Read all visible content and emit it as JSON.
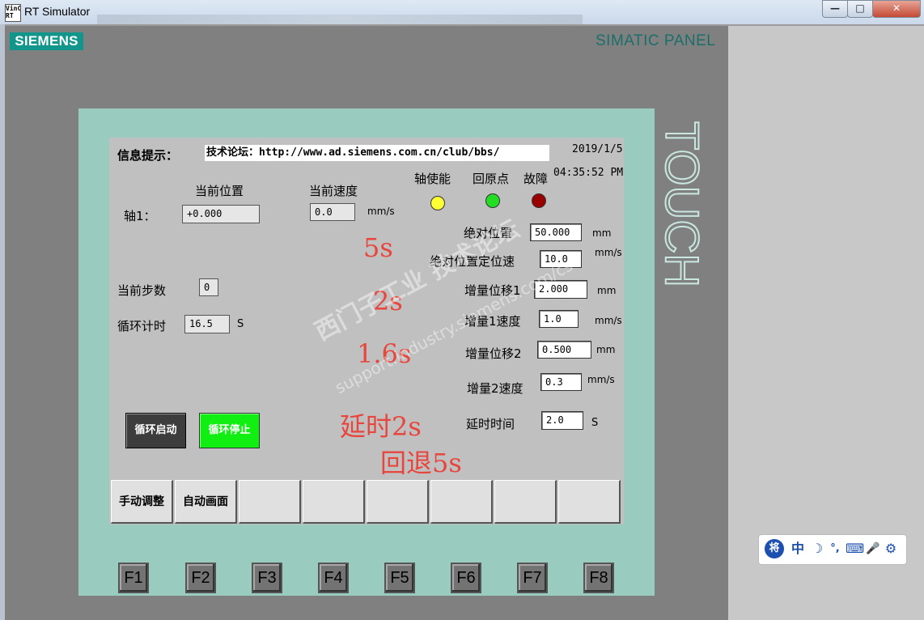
{
  "window": {
    "app_icon_text": "VinC\nRT",
    "title": "RT Simulator",
    "min_label": "—",
    "max_label": "□",
    "close_label": "✕"
  },
  "panel": {
    "brand": "SIEMENS",
    "model": "SIMATIC PANEL",
    "touch": "TOUCH"
  },
  "screen": {
    "info_label": "信息提示：",
    "info_text": "技术论坛：http://www.ad.siemens.com.cn/club/bbs/",
    "date": "2019/1/5",
    "time": "04:35:52 PM",
    "axis_label": "轴1：",
    "current_position_label": "当前位置",
    "current_position_value": "+0.000",
    "current_speed_label": "当前速度",
    "current_speed_value": "0.0",
    "current_speed_unit": "mm/s",
    "indicators": [
      {
        "label": "轴使能",
        "color": "#ffff33"
      },
      {
        "label": "回原点",
        "color": "#22dd22"
      },
      {
        "label": "故障",
        "color": "#990000"
      }
    ],
    "current_step_label": "当前步数",
    "current_step_value": "0",
    "cycle_time_label": "循环计时",
    "cycle_time_value": "16.5",
    "cycle_time_unit": "S",
    "params": [
      {
        "label": "绝对位置",
        "value": "50.000",
        "unit": "mm"
      },
      {
        "label": "绝对位置定位速",
        "value": "10.0",
        "unit": "mm/s"
      },
      {
        "label": "增量位移1",
        "value": "2.000",
        "unit": "mm"
      },
      {
        "label": "增量1速度",
        "value": "1.0",
        "unit": "mm/s"
      },
      {
        "label": "增量位移2",
        "value": "0.500",
        "unit": "mm"
      },
      {
        "label": "增量2速度",
        "value": "0.3",
        "unit": "mm/s"
      },
      {
        "label": "延时时间",
        "value": "2.0",
        "unit": "S"
      }
    ],
    "cycle_start": "循环启动",
    "cycle_stop": "循环停止",
    "annotations": [
      "5s",
      "2s",
      "1.6s",
      "延时2s",
      "回退5s"
    ],
    "fkey_tabs": [
      "手动调整",
      "自动画面",
      "",
      "",
      "",
      "",
      "",
      ""
    ],
    "fkeys": [
      "F1",
      "F2",
      "F3",
      "F4",
      "F5",
      "F6",
      "F7",
      "F8"
    ],
    "watermark_cn": "西门子工业 技术论坛",
    "watermark_en": "support.industry.siemens.com/cs"
  },
  "ime": {
    "items": [
      "将",
      "中",
      "☽",
      "°,",
      "⌨",
      "🎤",
      "⚙"
    ]
  }
}
